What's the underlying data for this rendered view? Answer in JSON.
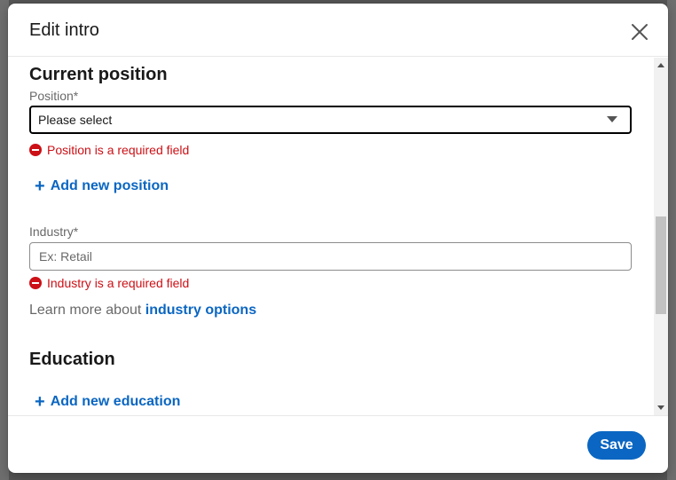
{
  "modal": {
    "title": "Edit intro",
    "close_icon": "close-icon"
  },
  "current_position": {
    "section_title": "Current position",
    "position_label": "Position*",
    "position_value": "Please select",
    "position_error": "Position is a required field",
    "add_position_label": "Add new position"
  },
  "industry": {
    "label": "Industry*",
    "placeholder": "Ex: Retail",
    "error": "Industry is a required field",
    "learn_more_prefix": "Learn more about",
    "learn_more_link": "industry options"
  },
  "education": {
    "section_title": "Education",
    "add_education_label": "Add new education"
  },
  "footer": {
    "save_label": "Save"
  },
  "colors": {
    "accent": "#0a66c2",
    "error": "#cc1016"
  }
}
